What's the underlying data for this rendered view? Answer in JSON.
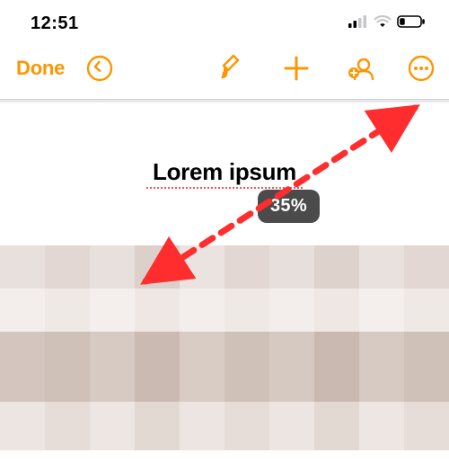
{
  "status": {
    "time": "12:51"
  },
  "toolbar": {
    "done_label": "Done"
  },
  "document": {
    "title": "Lorem ipsum",
    "zoom_label": "35%"
  },
  "colors": {
    "accent": "#ff9500",
    "annotation": "#ff2d2d"
  }
}
